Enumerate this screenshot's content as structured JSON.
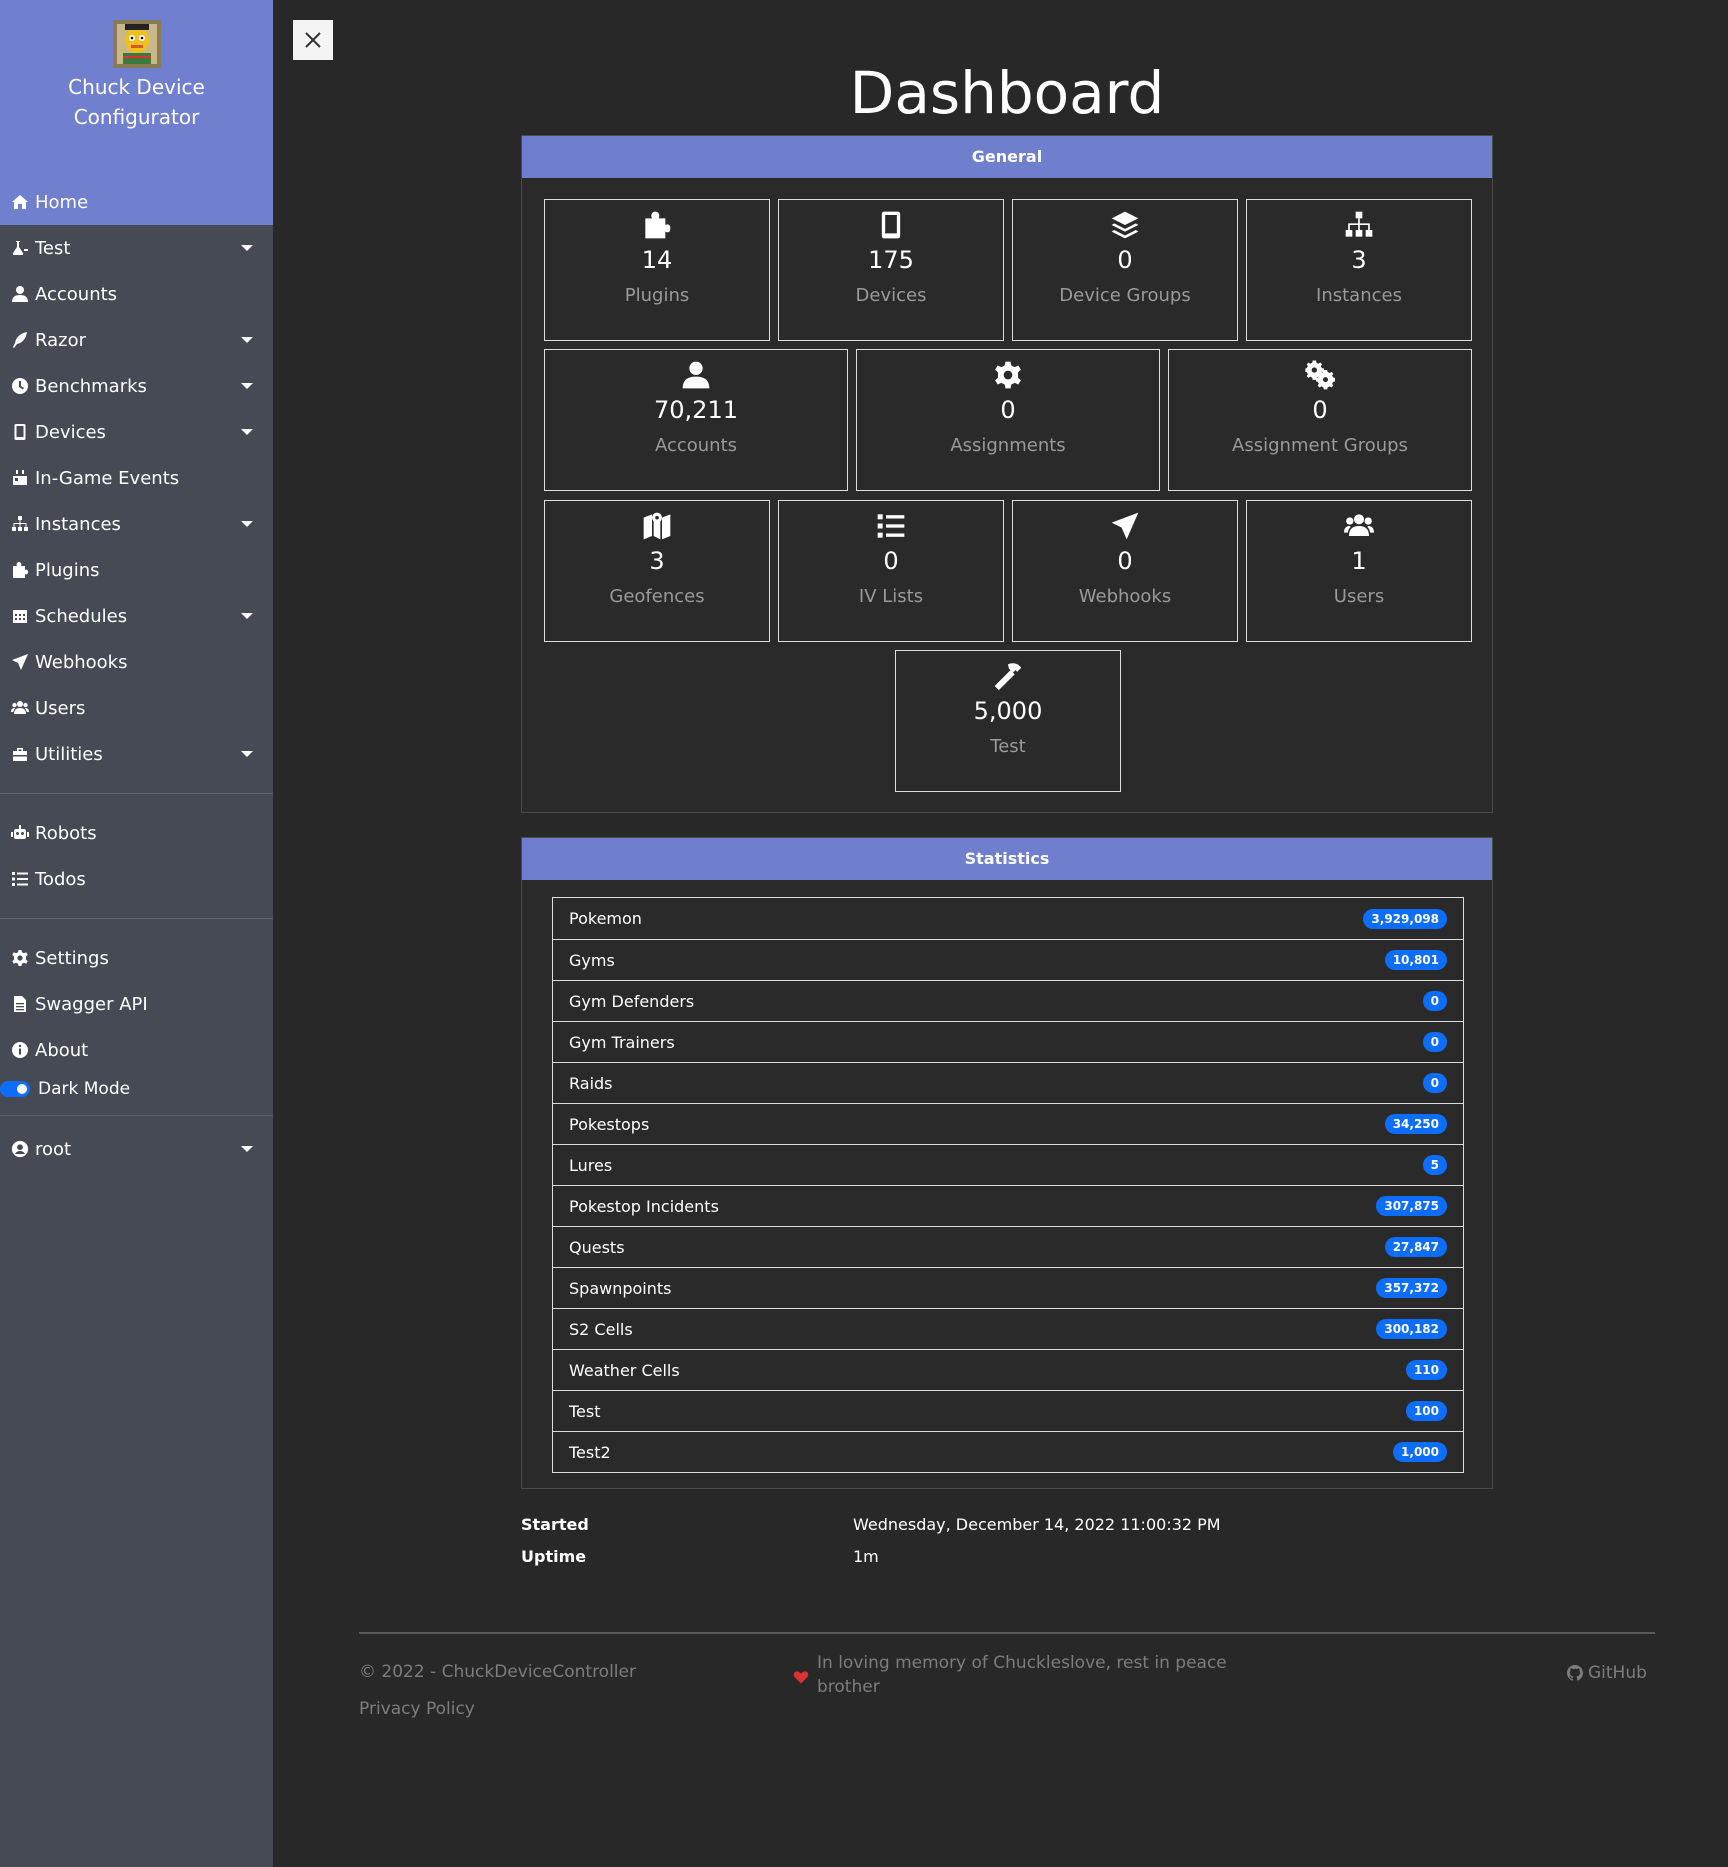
{
  "app": {
    "title_line1": "Chuck Device",
    "title_line2": "Configurator"
  },
  "sidebar": {
    "items": [
      {
        "label": "Home",
        "icon": "home-icon",
        "active": true,
        "dropdown": false
      },
      {
        "label": "Test",
        "icon": "flask-icon",
        "dropdown": true
      },
      {
        "label": "Accounts",
        "icon": "user-icon",
        "dropdown": false
      },
      {
        "label": "Razor",
        "icon": "feather-icon",
        "dropdown": true
      },
      {
        "label": "Benchmarks",
        "icon": "clock-icon",
        "dropdown": true
      },
      {
        "label": "Devices",
        "icon": "mobile-icon",
        "dropdown": true
      },
      {
        "label": "In-Game Events",
        "icon": "calendar-icon",
        "dropdown": false
      },
      {
        "label": "Instances",
        "icon": "sitemap-icon",
        "dropdown": true
      },
      {
        "label": "Plugins",
        "icon": "puzzle-icon",
        "dropdown": false
      },
      {
        "label": "Schedules",
        "icon": "calendar-grid-icon",
        "dropdown": true
      },
      {
        "label": "Webhooks",
        "icon": "paper-plane-icon",
        "dropdown": false
      },
      {
        "label": "Users",
        "icon": "users-icon",
        "dropdown": false
      },
      {
        "label": "Utilities",
        "icon": "toolbox-icon",
        "dropdown": true
      }
    ],
    "items2": [
      {
        "label": "Robots",
        "icon": "robot-icon"
      },
      {
        "label": "Todos",
        "icon": "list-icon"
      }
    ],
    "items3": [
      {
        "label": "Settings",
        "icon": "gear-icon"
      },
      {
        "label": "Swagger API",
        "icon": "file-icon"
      },
      {
        "label": "About",
        "icon": "info-icon"
      }
    ],
    "dark_mode_label": "Dark Mode",
    "user_label": "root"
  },
  "main": {
    "title": "Dashboard",
    "general": {
      "heading": "General",
      "tiles": [
        {
          "value": "14",
          "label": "Plugins",
          "icon": "puzzle-icon"
        },
        {
          "value": "175",
          "label": "Devices",
          "icon": "mobile-icon"
        },
        {
          "value": "0",
          "label": "Device Groups",
          "icon": "layers-icon"
        },
        {
          "value": "3",
          "label": "Instances",
          "icon": "sitemap-icon"
        },
        {
          "value": "70,211",
          "label": "Accounts",
          "icon": "user-icon"
        },
        {
          "value": "0",
          "label": "Assignments",
          "icon": "gear-icon"
        },
        {
          "value": "0",
          "label": "Assignment Groups",
          "icon": "gears-icon"
        },
        {
          "value": "3",
          "label": "Geofences",
          "icon": "map-icon"
        },
        {
          "value": "0",
          "label": "IV Lists",
          "icon": "list-icon"
        },
        {
          "value": "0",
          "label": "Webhooks",
          "icon": "paper-plane-icon"
        },
        {
          "value": "1",
          "label": "Users",
          "icon": "users-icon"
        },
        {
          "value": "5,000",
          "label": "Test",
          "icon": "hammer-icon"
        }
      ]
    },
    "statistics": {
      "heading": "Statistics",
      "rows": [
        {
          "label": "Pokemon",
          "value": "3,929,098"
        },
        {
          "label": "Gyms",
          "value": "10,801"
        },
        {
          "label": "Gym Defenders",
          "value": "0"
        },
        {
          "label": "Gym Trainers",
          "value": "0"
        },
        {
          "label": "Raids",
          "value": "0"
        },
        {
          "label": "Pokestops",
          "value": "34,250"
        },
        {
          "label": "Lures",
          "value": "5"
        },
        {
          "label": "Pokestop Incidents",
          "value": "307,875"
        },
        {
          "label": "Quests",
          "value": "27,847"
        },
        {
          "label": "Spawnpoints",
          "value": "357,372"
        },
        {
          "label": "S2 Cells",
          "value": "300,182"
        },
        {
          "label": "Weather Cells",
          "value": "110"
        },
        {
          "label": "Test",
          "value": "100"
        },
        {
          "label": "Test2",
          "value": "1,000"
        }
      ]
    },
    "info": {
      "started_label": "Started",
      "started_value": "Wednesday, December 14, 2022 11:00:32 PM",
      "uptime_label": "Uptime",
      "uptime_value": "1m"
    }
  },
  "footer": {
    "copyright": "© 2022 - ChuckDeviceController",
    "privacy": "Privacy Policy",
    "memory_line1": "In loving memory of Chuckleslove, rest in peace",
    "memory_line2": "brother",
    "github": "GitHub"
  },
  "colors": {
    "accent": "#7080cf",
    "badge": "#0d6efd",
    "heart": "#e03131"
  }
}
